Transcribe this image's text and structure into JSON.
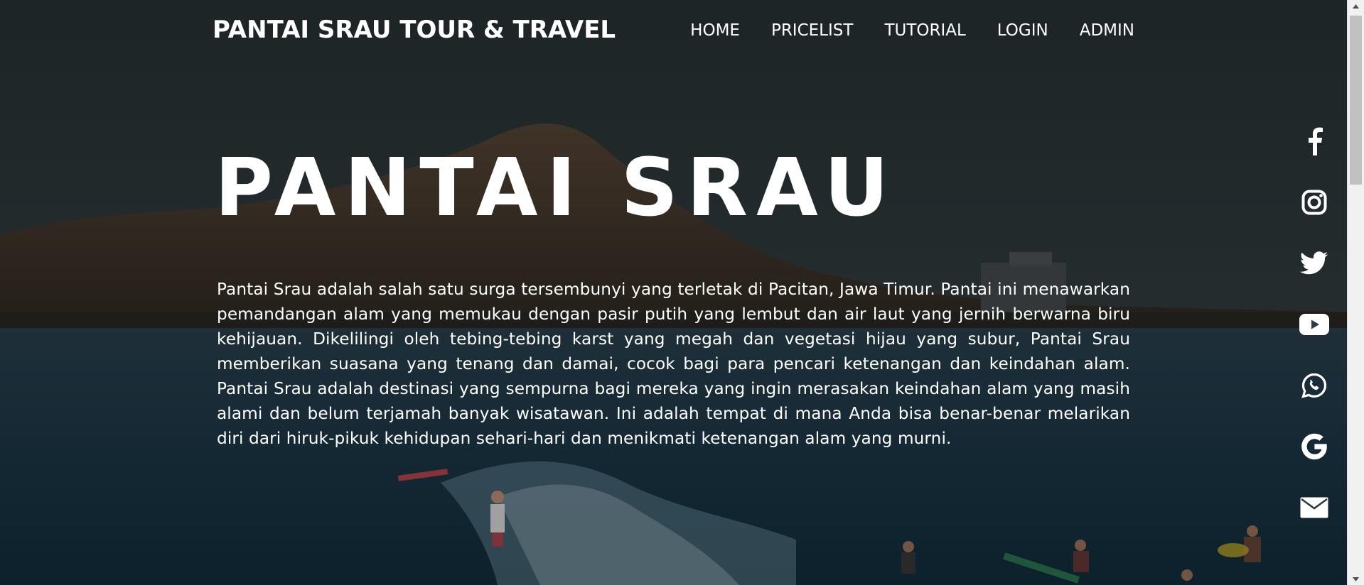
{
  "header": {
    "brand": "PANTAI SRAU TOUR & TRAVEL",
    "nav": [
      "HOME",
      "PRICELIST",
      "TUTORIAL",
      "LOGIN",
      "ADMIN"
    ]
  },
  "hero": {
    "title": "PANTAI SRAU",
    "description": "Pantai Srau adalah salah satu surga tersembunyi yang terletak di Pacitan, Jawa Timur. Pantai ini menawarkan pemandangan alam yang memukau dengan pasir putih yang lembut dan air laut yang jernih berwarna biru kehijauan. Dikelilingi oleh tebing-tebing karst yang megah dan vegetasi hijau yang subur, Pantai Srau memberikan suasana yang tenang dan damai, cocok bagi para pencari ketenangan dan keindahan alam. Pantai Srau adalah destinasi yang sempurna bagi mereka yang ingin merasakan keindahan alam yang masih alami dan belum terjamah banyak wisatawan. Ini adalah tempat di mana Anda bisa benar-benar melarikan diri dari hiruk-pikuk kehidupan sehari-hari dan menikmati ketenangan alam yang murni."
  },
  "social": [
    "facebook-icon",
    "instagram-icon",
    "twitter-icon",
    "youtube-icon",
    "whatsapp-icon",
    "google-icon",
    "email-icon"
  ],
  "colors": {
    "text": "#ffffff",
    "overlay": "rgba(0,0,0,0.30)",
    "sea": "#1f3f52",
    "sky": "#2a3a40"
  }
}
